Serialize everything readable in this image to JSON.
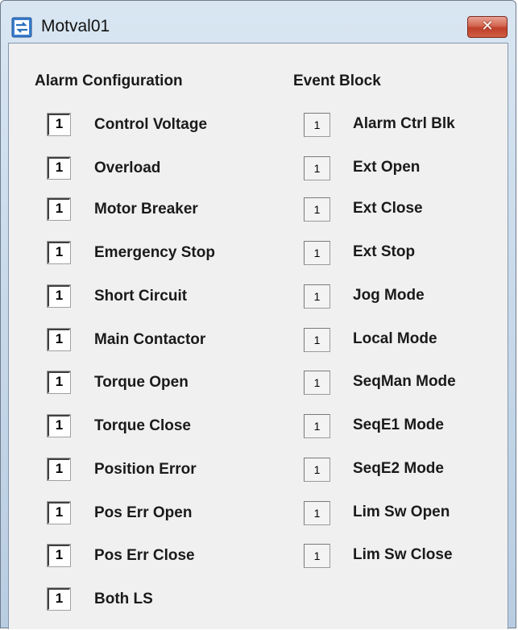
{
  "window": {
    "title": "Motval01",
    "close_label": "✕"
  },
  "alarm_configuration": {
    "heading": "Alarm Configuration",
    "items": [
      {
        "label": "Control Voltage",
        "value": "1"
      },
      {
        "label": "Overload",
        "value": "1"
      },
      {
        "label": "Motor Breaker",
        "value": "1"
      },
      {
        "label": "Emergency Stop",
        "value": "1"
      },
      {
        "label": "Short Circuit",
        "value": "1"
      },
      {
        "label": "Main Contactor",
        "value": "1"
      },
      {
        "label": "Torque Open",
        "value": "1"
      },
      {
        "label": "Torque Close",
        "value": "1"
      },
      {
        "label": "Position Error",
        "value": "1"
      },
      {
        "label": "Pos Err Open",
        "value": "1"
      },
      {
        "label": "Pos Err Close",
        "value": "1"
      },
      {
        "label": "Both LS",
        "value": "1"
      }
    ]
  },
  "event_block": {
    "heading": "Event Block",
    "items": [
      {
        "label": "Alarm Ctrl Blk",
        "value": "1"
      },
      {
        "label": "Ext Open",
        "value": "1"
      },
      {
        "label": "Ext Close",
        "value": "1"
      },
      {
        "label": "Ext Stop",
        "value": "1"
      },
      {
        "label": "Jog Mode",
        "value": "1"
      },
      {
        "label": "Local Mode",
        "value": "1"
      },
      {
        "label": "SeqMan Mode",
        "value": "1"
      },
      {
        "label": "SeqE1 Mode",
        "value": "1"
      },
      {
        "label": "SeqE2 Mode",
        "value": "1"
      },
      {
        "label": "Lim Sw Open",
        "value": "1"
      },
      {
        "label": "Lim Sw Close",
        "value": "1"
      }
    ]
  }
}
